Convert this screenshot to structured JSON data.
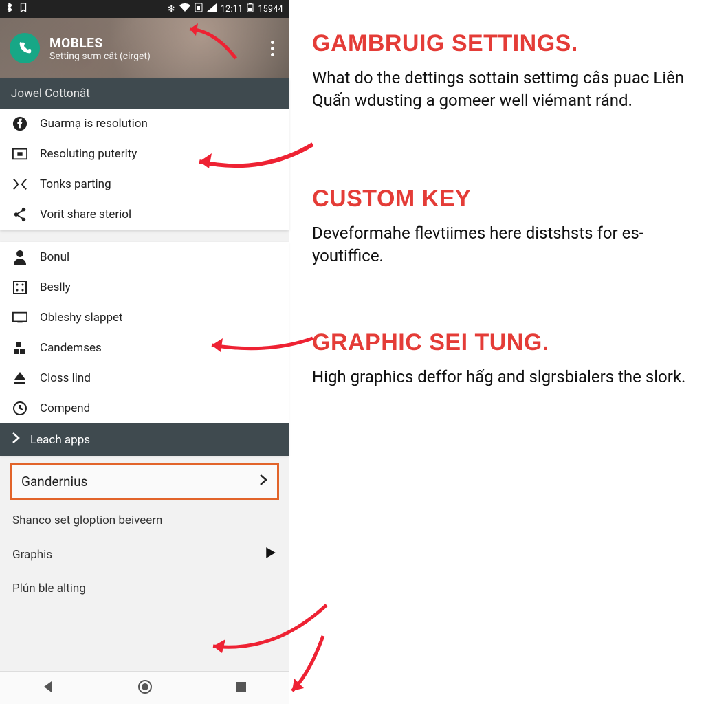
{
  "status": {
    "left_icons": [
      "bluetooth-icon",
      "bookmark-icon"
    ],
    "right_icons": [
      "gear-icon",
      "wifi-icon",
      "sim-icon",
      "signal-icon"
    ],
    "time": "12:11",
    "battery_icon": "battery-icon",
    "battery_text": "15944"
  },
  "header": {
    "title": "MOBLES",
    "subtitle": "Setting sưm cât (cirget)"
  },
  "section1": {
    "title": "Jowel Cottonât",
    "rows": [
      {
        "icon": "facebook-icon",
        "label": "Guarmạ is resolution"
      },
      {
        "icon": "frame-icon",
        "label": "Resoluting puterity"
      },
      {
        "icon": "shuffle-icon",
        "label": "Tonks parting"
      },
      {
        "icon": "share-icon",
        "label": "Vorit share steriol"
      }
    ]
  },
  "section2": {
    "rows": [
      {
        "icon": "person-icon",
        "label": "Bonul"
      },
      {
        "icon": "dice-icon",
        "label": "Beslly"
      },
      {
        "icon": "monitor-icon",
        "label": "Obleshy slappet"
      },
      {
        "icon": "blocks-icon",
        "label": "Candemses"
      },
      {
        "icon": "eject-icon",
        "label": "Closs lind"
      },
      {
        "icon": "clock-icon",
        "label": "Compend"
      }
    ]
  },
  "leach": {
    "label": "Leach apps"
  },
  "gander": {
    "label": "Gandernius"
  },
  "footer": {
    "text1": "Shanco set gloption beiveern",
    "graphis": "Graphis",
    "plun": "Plún ble alting"
  },
  "notes": {
    "n1": {
      "title": "GAMBRUIG SETTINGS.",
      "body": "What do the dettings sottain settimg câs puac Liên Quấn wdusting a gomeer well viémant ránd."
    },
    "n2": {
      "title": "CUSTOM KEY",
      "body": "Deveformahe flevtiimes here distshsts for es-youtiffice."
    },
    "n3": {
      "title": "GRAPHIC SEI TUNG.",
      "body": "High graphics deffor hấg and slgrsbialers the slork."
    }
  }
}
